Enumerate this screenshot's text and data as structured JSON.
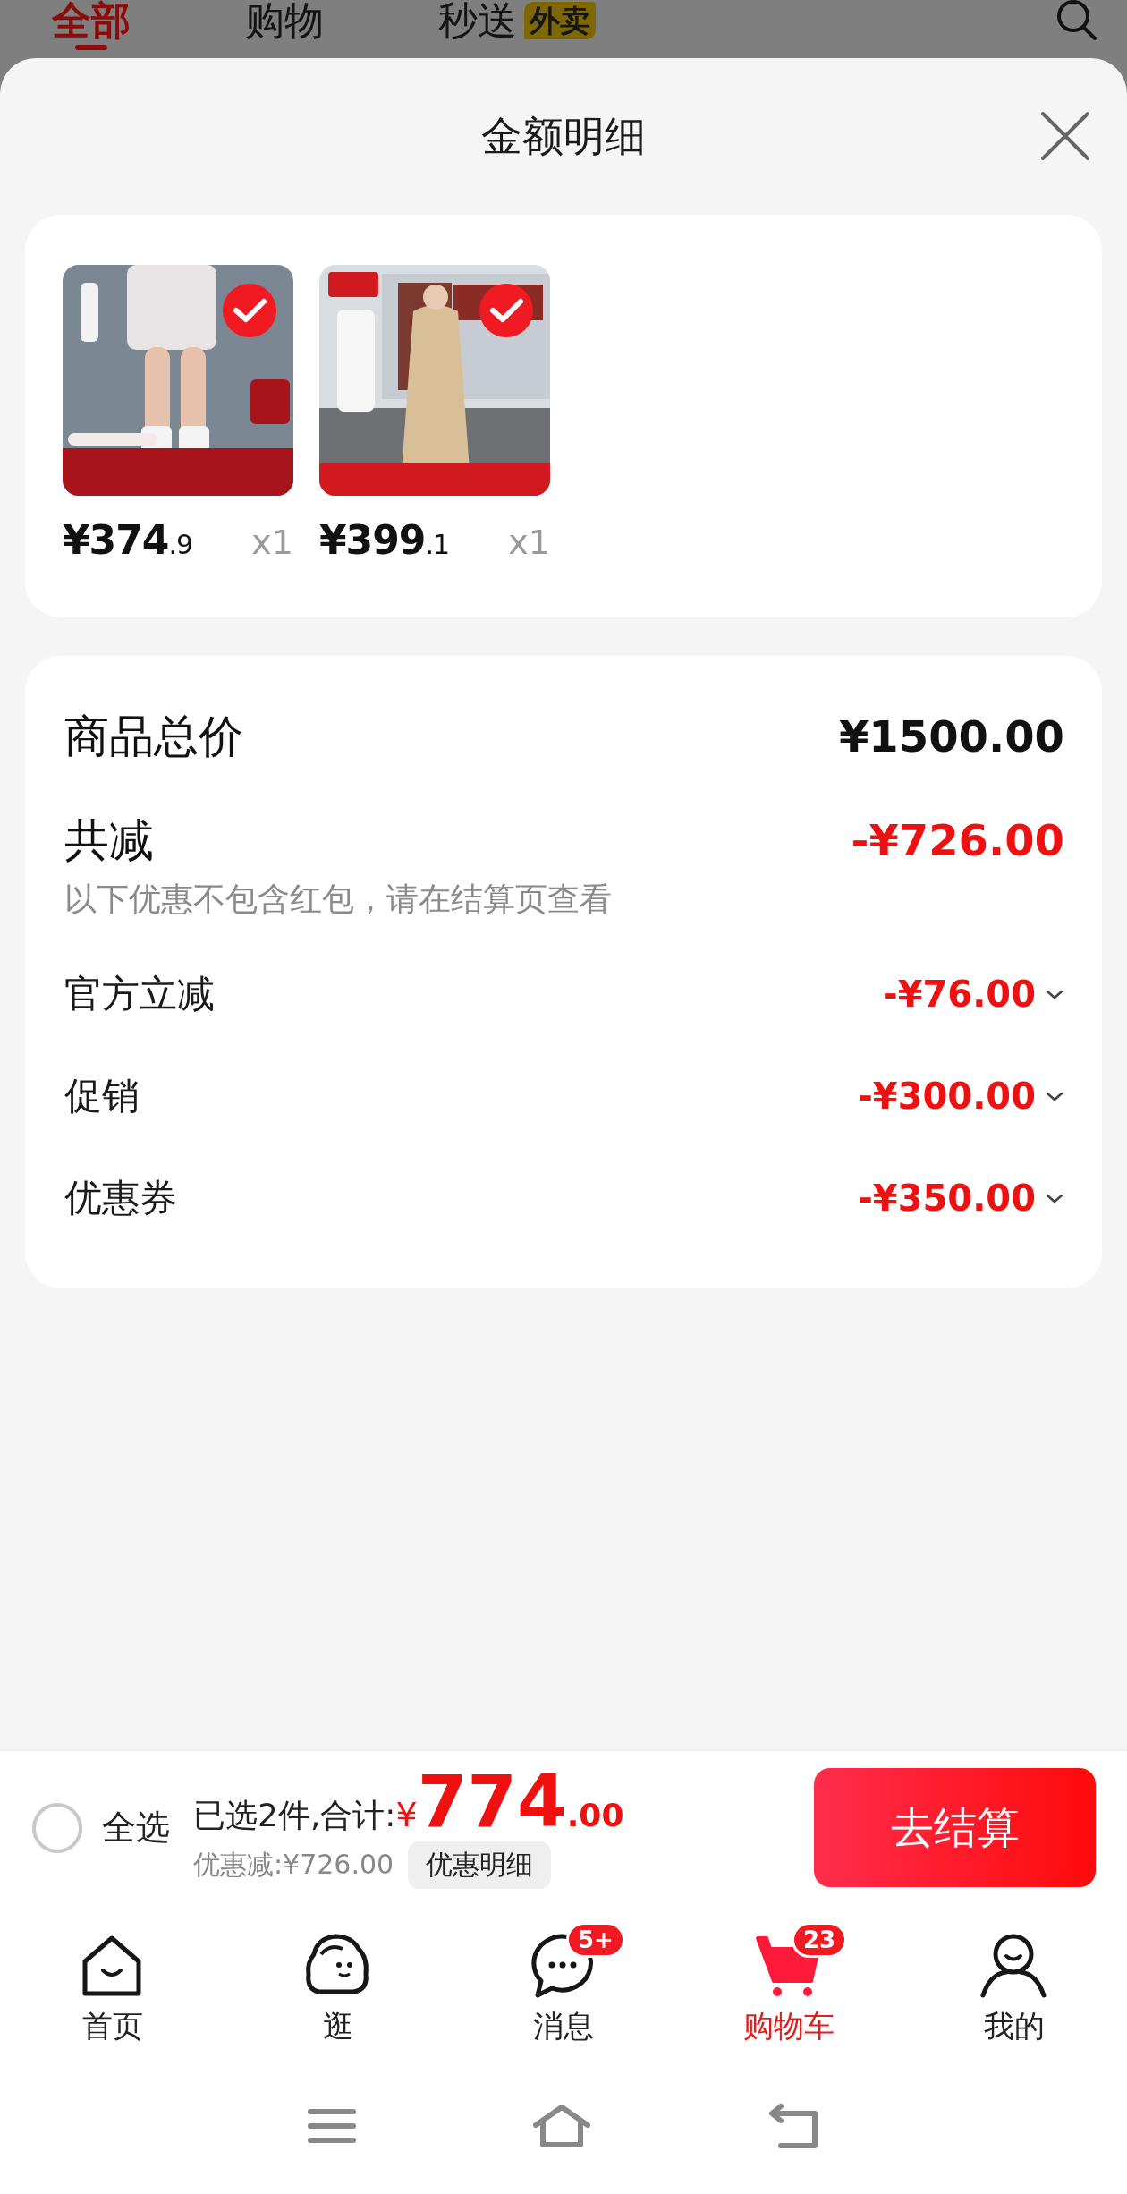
{
  "top_tabs": [
    {
      "label": "全部",
      "selected": true
    },
    {
      "label": "购物",
      "selected": false
    },
    {
      "label": "秒送",
      "badge": "外卖",
      "selected": false
    }
  ],
  "sheet": {
    "title": "金额明细"
  },
  "items": [
    {
      "price": "¥374",
      "price_decimal": ".9",
      "quantity": "x1",
      "selected": true
    },
    {
      "price": "¥399",
      "price_decimal": ".1",
      "quantity": "x1",
      "selected": true
    }
  ],
  "summary": {
    "total_label": "商品总价",
    "total_value": "¥1500.00",
    "discount_label": "共减",
    "discount_value": "-¥726.00",
    "discount_note": "以下优惠不包含红包，请在结算页查看",
    "discounts": [
      {
        "label": "官方立减",
        "value": "-¥76.00",
        "expanded": false
      },
      {
        "label": "促销",
        "value": "-¥300.00",
        "expanded": false
      },
      {
        "label": "优惠券",
        "value": "-¥350.00",
        "expanded": false
      }
    ]
  },
  "checkout": {
    "select_all": {
      "label": "全选",
      "checked": false
    },
    "selected_text": "已选2件,合计:",
    "currency": "¥",
    "amount": "774",
    "amount_decimal": ".00",
    "saved": "优惠减:¥726.00",
    "details_button": "优惠明细",
    "checkout_button": "去结算"
  },
  "nav": [
    {
      "kind": "home",
      "label": "首页",
      "selected": false
    },
    {
      "kind": "stroll",
      "label": "逛",
      "selected": false
    },
    {
      "kind": "message",
      "label": "消息",
      "badge": "5+",
      "selected": false
    },
    {
      "kind": "cart",
      "label": "购物车",
      "badge": "23",
      "selected": true
    },
    {
      "kind": "profile",
      "label": "我的",
      "selected": false
    }
  ]
}
